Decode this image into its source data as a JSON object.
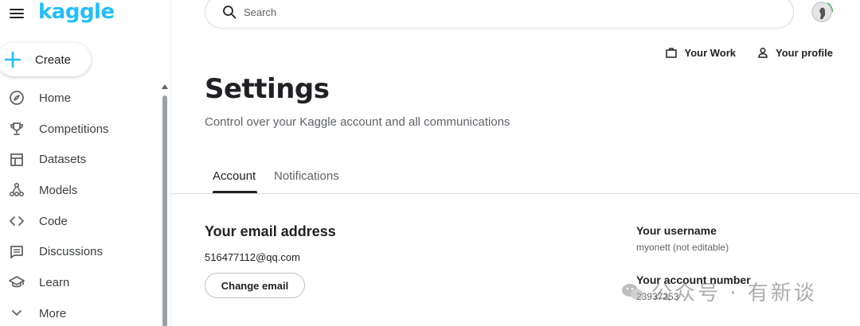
{
  "sidebar": {
    "logo": "kaggle",
    "create_label": "Create",
    "items": [
      {
        "label": "Home",
        "icon": "compass-icon"
      },
      {
        "label": "Competitions",
        "icon": "trophy-icon"
      },
      {
        "label": "Datasets",
        "icon": "table-icon"
      },
      {
        "label": "Models",
        "icon": "models-icon"
      },
      {
        "label": "Code",
        "icon": "code-icon"
      },
      {
        "label": "Discussions",
        "icon": "comment-icon"
      },
      {
        "label": "Learn",
        "icon": "school-icon"
      },
      {
        "label": "More",
        "icon": "chevron-down-icon"
      }
    ]
  },
  "header": {
    "search_placeholder": "Search",
    "your_work": "Your Work",
    "your_profile": "Your profile"
  },
  "page": {
    "title": "Settings",
    "subtitle": "Control over your Kaggle account and all communications",
    "tabs": [
      {
        "label": "Account",
        "active": true
      },
      {
        "label": "Notifications",
        "active": false
      }
    ]
  },
  "account": {
    "email_title": "Your email address",
    "email_value": "516477112@qq.com",
    "change_email": "Change email",
    "username_label": "Your username",
    "username_value": "myonett (not editable)",
    "account_number_label": "Your account number",
    "account_number_value": "23937253"
  },
  "watermark": {
    "text": "公众号 · 有新谈"
  },
  "colors": {
    "brand": "#20beff",
    "text": "#202124",
    "muted": "#5f6368"
  }
}
